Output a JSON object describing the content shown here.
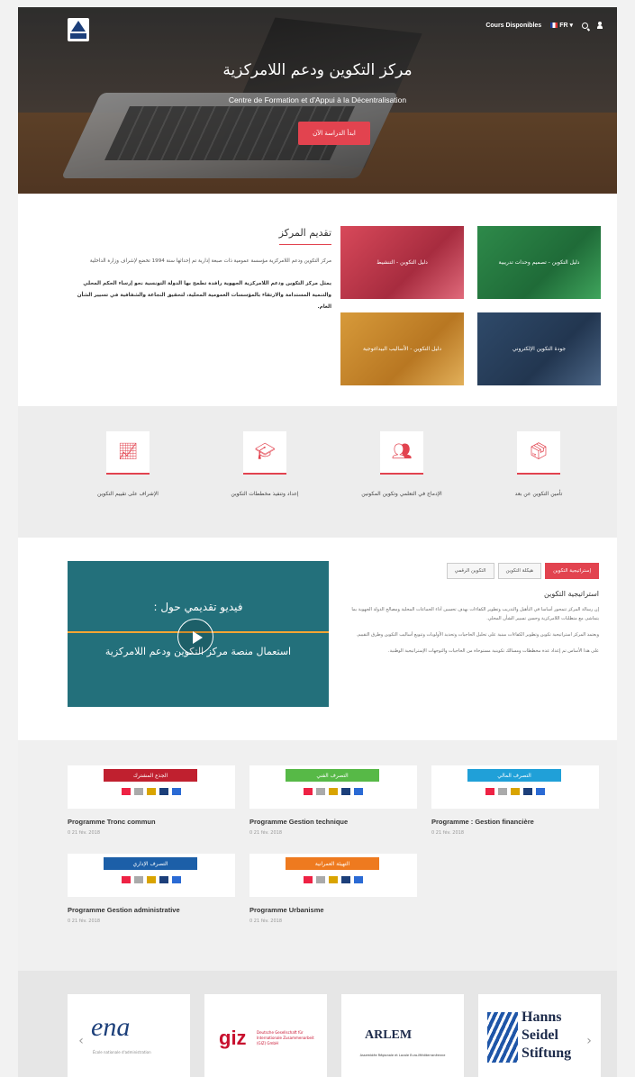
{
  "header": {
    "nav_courses": "Cours Disponibles",
    "nav_lang": "FR",
    "search_icon": "search-icon",
    "user_icon": "user-icon"
  },
  "hero": {
    "title": "مركز التكوين ودعم اللامركزية",
    "subtitle": "Centre de Formation et d'Appui à la Décentralisation",
    "button": "ابدأ الدراسة الآن"
  },
  "intro": {
    "title": "تقديم المركز",
    "p1": "مركز التكوين ودعم اللامركزية مؤسسة عمومية ذات صبغة إدارية تم إحداثها سنة 1994 تخضع لإشراف وزارة الداخلية",
    "p2": "يمثل مركز التكوين ودعم اللامركزية الجهوية رافدة تطمح بها الدولة التونسية نحو إرساء الحكم المحلي والتنمية المستدامة والارتقاء بالمؤسسات العمومية المحلية، لتحقيق النجاعة والشفافية في تسيير الشأن العام."
  },
  "tiles": [
    {
      "label": "دليل التكوين - التنشيط"
    },
    {
      "label": "دليل التكوين - تصميم وحدات تدريبية"
    },
    {
      "label": "دليل التكوين - الأساليب البيداغوجية"
    },
    {
      "label": "جودة التكوين الإلكتروني"
    }
  ],
  "features": [
    {
      "label": "الإشراف على تقييم التكوين",
      "icon": "chart-icon"
    },
    {
      "label": "إعداد وتنفيذ مخططات التكوين",
      "icon": "graduation-cap-icon"
    },
    {
      "label": "الإدماج في التعلمي وتكوين المكونين",
      "icon": "users-icon"
    },
    {
      "label": "تأمين التكوين عن بعد",
      "icon": "box-icon"
    }
  ],
  "video": {
    "line1": "فيديو تقديمي حول :",
    "line2": "استعمال منصة مركز التكوين ودعم اللامركزية"
  },
  "tabs": [
    {
      "label": "إستراتيجية التكوين",
      "active": true
    },
    {
      "label": "هيكلة التكوين",
      "active": false
    },
    {
      "label": "التكوين الرقمي",
      "active": false
    }
  ],
  "tab_content": {
    "title": "استراتيجية التكوين",
    "p1": "إن رسالة المركز تتمحور أساسا في التأهيل والتدريب وتطوير الكفاءات بهدف تحسين أداء الجماعات المحلية ومصالح الدولة الجهوية بما يتماشى مع متطلبات اللامركزية وحسن تسيير الشأن المحلي.",
    "p2": "ويعتمد المركز استراتيجية تكوين وتطوير الكفاءات مبنية على تحليل الحاجيات وتحديد الأولويات وتنويع أساليب التكوين وطرق التقييم.",
    "p3": "على هذا الأساس تم إعداد عدة مخططات ومسالك تكوينية مستوحاة من الحاجيات والتوجهات الإستراتيجية الوطنية."
  },
  "programmes": [
    {
      "title": "Programme Tronc commun",
      "tag": "الجذع المشترك",
      "color": "#c0202f",
      "meta": "0   21 fév. 2018"
    },
    {
      "title": "Programme Gestion technique",
      "tag": "التصرف الفني",
      "color": "#57b947",
      "meta": "0   21 fév. 2018"
    },
    {
      "title": "Programme : Gestion financière",
      "tag": "التصرف المالي",
      "color": "#20a0d8",
      "meta": "0   21 fév. 2018"
    },
    {
      "title": "Programme Gestion administrative",
      "tag": "التصرف الإداري",
      "color": "#1c5fa8",
      "meta": "0   21 fév. 2018"
    },
    {
      "title": "Programme Urbanisme",
      "tag": "التهيئة العمرانية",
      "color": "#ee7a1f",
      "meta": "0   21 fév. 2018"
    }
  ],
  "partners": {
    "ena": "ena",
    "ena_sub": "École nationale d'administration",
    "giz": "giz",
    "giz_sub": "Deutsche Gesellschaft für Internationale Zusammenarbeit (GIZ) GmbH",
    "arlem": "ARLEM",
    "arlem_sub": "Assemblée Régionale et Locale Euro-Méditerranéenne",
    "hss": "Hanns Seidel Stiftung"
  },
  "colors": {
    "accent": "#e2434f",
    "video_bg": "#23707b"
  }
}
